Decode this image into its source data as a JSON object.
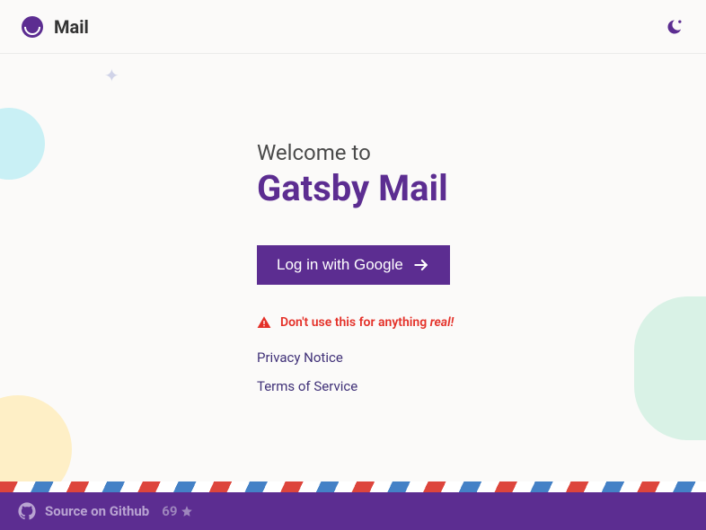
{
  "header": {
    "brand_name": "Mail"
  },
  "main": {
    "welcome_pre": "Welcome to",
    "welcome_title": "Gatsby Mail",
    "login_label": "Log in with Google",
    "warning_prefix": "Don't use this for anything ",
    "warning_em": "real!",
    "privacy_link": "Privacy Notice",
    "terms_link": "Terms of Service"
  },
  "footer": {
    "source_label": "Source on Github",
    "stars": "69"
  }
}
